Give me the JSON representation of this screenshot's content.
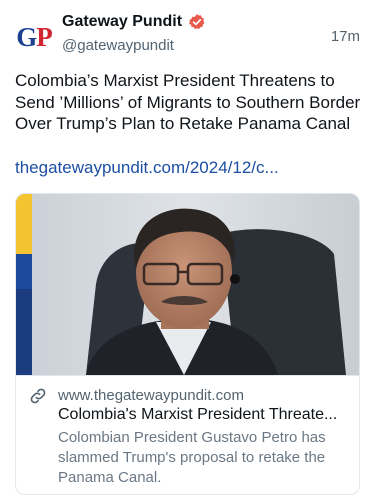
{
  "account": {
    "name": "Gateway Pundit",
    "handle": "@gatewaypundit",
    "time_ago": "17m",
    "avatar_letters": "GP"
  },
  "post": {
    "text": "Colombia’s Marxist President Threatens to Send ’Millions’ of Migrants to Southern Border Over Trump’s Plan to Retake Panama Canal",
    "link": "thegatewaypundit.com/2024/12/c..."
  },
  "link_card": {
    "domain": "www.thegatewaypundit.com",
    "title": "Colombia's Marxist President Threate...",
    "description": "Colombian President Gustavo Petro has slammed Trump's proposal to retake the Panama Canal."
  },
  "colors": {
    "link": "#1d4fa3",
    "verified_badge": "#e8594b",
    "muted_text": "#536471"
  }
}
